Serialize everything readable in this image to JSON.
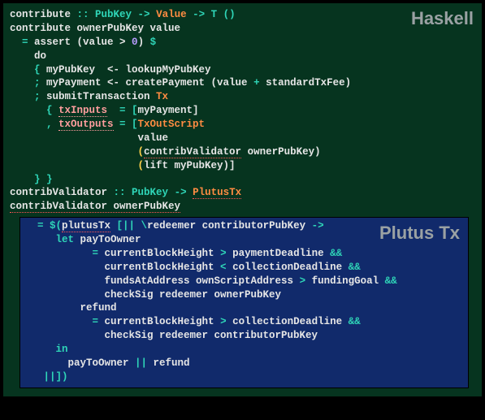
{
  "labels": {
    "haskell": "Haskell",
    "plutus": "Plutus Tx"
  },
  "haskell": {
    "l1_a": "contribute ",
    "l1_b": ":: ",
    "l1_c": "PubKey",
    "l1_d": " -> ",
    "l1_e": "Value",
    "l1_f": " -> ",
    "l1_g": "T ()",
    "l2": "contribute ownerPubKey value",
    "l3_a": "  = ",
    "l3_b": "assert (value > ",
    "l3_c": "0",
    "l3_d": ") ",
    "l3_e": "$",
    "l4": "    do",
    "l5_a": "    { ",
    "l5_b": "myPubKey  <- lookupMyPubKey",
    "l6_a": "    ; ",
    "l6_b": "myPayment <- createPayment (value ",
    "l6_c": "+",
    "l6_d": " standardTxFee)",
    "l7_a": "    ; ",
    "l7_b": "submitTransaction ",
    "l7_c": "Tx",
    "l8_a": "      { ",
    "l8_b": "txInputs",
    "l8_c": "  = [",
    "l8_d": "myPayment]",
    "l9_a": "      , ",
    "l9_b": "txOutputs",
    "l9_c": " = [",
    "l9_d": "TxOutScript",
    "l10": "                     value",
    "l11_a": "                     (",
    "l11_b": "contribValidator",
    "l11_c": " ownerPubKey)",
    "l12_a": "                     (",
    "l12_b": "lift myPubKey)]",
    "l13": "    } }",
    "l14_a": "contribValidator ",
    "l14_b": ":: ",
    "l14_c": "PubKey",
    "l14_d": " -> ",
    "l14_e": "PlutusTx",
    "l15": "contribValidator ownerPubKey",
    "l16_a": "  = ",
    "l16_b": "$(",
    "l16_c": "plutusTx",
    "l16_d": " [|| \\",
    "l16_e": "redeemer contributorPubKey ",
    "l16_f": "->"
  },
  "plutus": {
    "l1_a": "     let ",
    "l1_b": "payToOwner",
    "l2_a": "           = ",
    "l2_b": "currentBlockHeight ",
    "l2_c": ">",
    "l2_d": " paymentDeadline ",
    "l2_e": "&&",
    "l3_a": "             currentBlockHeight ",
    "l3_b": "<",
    "l3_c": " collectionDeadline ",
    "l3_d": "&&",
    "l4_a": "             fundsAtAddress ownScriptAddress ",
    "l4_b": ">",
    "l4_c": " fundingGoal ",
    "l4_d": "&&",
    "l5": "             checkSig redeemer ownerPubKey",
    "l6": "         refund",
    "l7_a": "           = ",
    "l7_b": "currentBlockHeight ",
    "l7_c": ">",
    "l7_d": " collectionDeadline ",
    "l7_e": "&&",
    "l8": "             checkSig redeemer contributorPubKey",
    "l9": "     in",
    "l10_a": "       payToOwner ",
    "l10_b": "||",
    "l10_c": " refund",
    "l11": "   ||])"
  }
}
